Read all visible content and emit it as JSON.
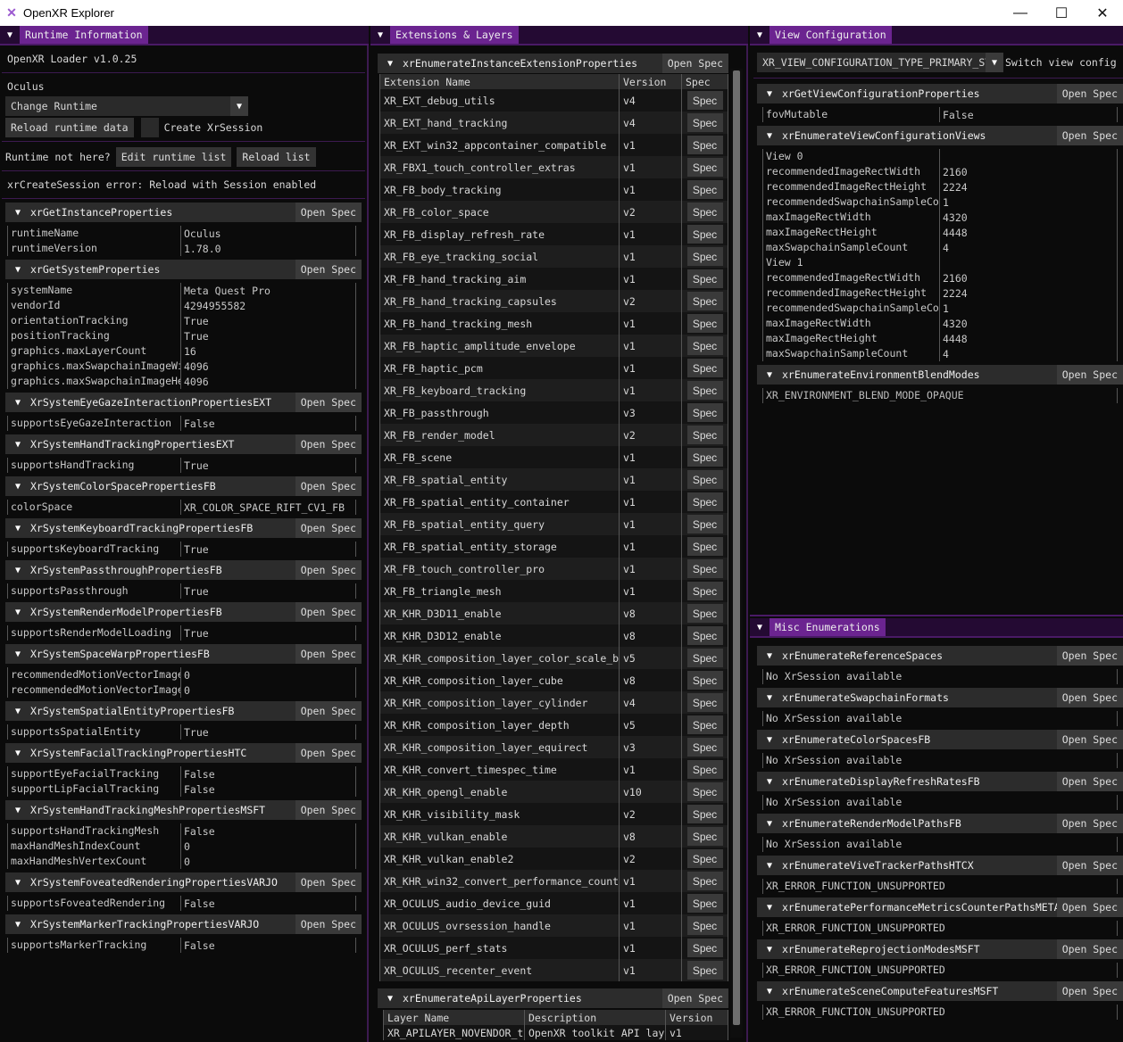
{
  "window": {
    "title": "OpenXR Explorer",
    "minimize": "—",
    "maximize": "☐",
    "close": "✕"
  },
  "runtime": {
    "tab": "Runtime Information",
    "loader": "OpenXR Loader v1.0.25",
    "runtime_name": "Oculus",
    "change_runtime": "Change Runtime",
    "reload_runtime": "Reload runtime data",
    "create_session": "Create XrSession",
    "create_session_checked": false,
    "not_here": "Runtime not here?",
    "edit_list": "Edit runtime list",
    "reload_list": "Reload list",
    "error": "xrCreateSession error: Reload with Session enabled",
    "open_spec": "Open Spec",
    "sections": [
      {
        "name": "xrGetInstanceProperties",
        "rows": [
          [
            "runtimeName",
            "Oculus"
          ],
          [
            "runtimeVersion",
            "1.78.0"
          ]
        ]
      },
      {
        "name": "xrGetSystemProperties",
        "rows": [
          [
            "systemName",
            "Meta Quest Pro"
          ],
          [
            "vendorId",
            "4294955582"
          ],
          [
            "orientationTracking",
            "True"
          ],
          [
            "positionTracking",
            "True"
          ],
          [
            "graphics.maxLayerCount",
            "16"
          ],
          [
            "graphics.maxSwapchainImageWi",
            "4096"
          ],
          [
            "graphics.maxSwapchainImageHe",
            "4096"
          ]
        ]
      },
      {
        "name": "XrSystemEyeGazeInteractionPropertiesEXT",
        "rows": [
          [
            "supportsEyeGazeInteraction",
            "False"
          ]
        ]
      },
      {
        "name": "XrSystemHandTrackingPropertiesEXT",
        "rows": [
          [
            "supportsHandTracking",
            "True"
          ]
        ]
      },
      {
        "name": "XrSystemColorSpacePropertiesFB",
        "rows": [
          [
            "colorSpace",
            "XR_COLOR_SPACE_RIFT_CV1_FB"
          ]
        ]
      },
      {
        "name": "XrSystemKeyboardTrackingPropertiesFB",
        "rows": [
          [
            "supportsKeyboardTracking",
            "True"
          ]
        ]
      },
      {
        "name": "XrSystemPassthroughPropertiesFB",
        "rows": [
          [
            "supportsPassthrough",
            "True"
          ]
        ]
      },
      {
        "name": "XrSystemRenderModelPropertiesFB",
        "rows": [
          [
            "supportsRenderModelLoading",
            "True"
          ]
        ]
      },
      {
        "name": "XrSystemSpaceWarpPropertiesFB",
        "rows": [
          [
            "recommendedMotionVectorImage",
            "0"
          ],
          [
            "recommendedMotionVectorImage",
            "0"
          ]
        ]
      },
      {
        "name": "XrSystemSpatialEntityPropertiesFB",
        "rows": [
          [
            "supportsSpatialEntity",
            "True"
          ]
        ]
      },
      {
        "name": "XrSystemFacialTrackingPropertiesHTC",
        "rows": [
          [
            "supportEyeFacialTracking",
            "False"
          ],
          [
            "supportLipFacialTracking",
            "False"
          ]
        ]
      },
      {
        "name": "XrSystemHandTrackingMeshPropertiesMSFT",
        "rows": [
          [
            "supportsHandTrackingMesh",
            "False"
          ],
          [
            "maxHandMeshIndexCount",
            "0"
          ],
          [
            "maxHandMeshVertexCount",
            "0"
          ]
        ]
      },
      {
        "name": "XrSystemFoveatedRenderingPropertiesVARJO",
        "rows": [
          [
            "supportsFoveatedRendering",
            "False"
          ]
        ]
      },
      {
        "name": "XrSystemMarkerTrackingPropertiesVARJO",
        "rows": [
          [
            "supportsMarkerTracking",
            "False"
          ]
        ]
      }
    ]
  },
  "extensions": {
    "tab": "Extensions & Layers",
    "instance_header": "xrEnumerateInstanceExtensionProperties",
    "open_spec": "Open Spec",
    "columns": [
      "Extension Name",
      "Version",
      "Spec"
    ],
    "spec_label": "Spec",
    "rows": [
      [
        "XR_EXT_debug_utils",
        "v4"
      ],
      [
        "XR_EXT_hand_tracking",
        "v4"
      ],
      [
        "XR_EXT_win32_appcontainer_compatible",
        "v1"
      ],
      [
        "XR_FBX1_touch_controller_extras",
        "v1"
      ],
      [
        "XR_FB_body_tracking",
        "v1"
      ],
      [
        "XR_FB_color_space",
        "v2"
      ],
      [
        "XR_FB_display_refresh_rate",
        "v1"
      ],
      [
        "XR_FB_eye_tracking_social",
        "v1"
      ],
      [
        "XR_FB_hand_tracking_aim",
        "v1"
      ],
      [
        "XR_FB_hand_tracking_capsules",
        "v2"
      ],
      [
        "XR_FB_hand_tracking_mesh",
        "v1"
      ],
      [
        "XR_FB_haptic_amplitude_envelope",
        "v1"
      ],
      [
        "XR_FB_haptic_pcm",
        "v1"
      ],
      [
        "XR_FB_keyboard_tracking",
        "v1"
      ],
      [
        "XR_FB_passthrough",
        "v3"
      ],
      [
        "XR_FB_render_model",
        "v2"
      ],
      [
        "XR_FB_scene",
        "v1"
      ],
      [
        "XR_FB_spatial_entity",
        "v1"
      ],
      [
        "XR_FB_spatial_entity_container",
        "v1"
      ],
      [
        "XR_FB_spatial_entity_query",
        "v1"
      ],
      [
        "XR_FB_spatial_entity_storage",
        "v1"
      ],
      [
        "XR_FB_touch_controller_pro",
        "v1"
      ],
      [
        "XR_FB_triangle_mesh",
        "v1"
      ],
      [
        "XR_KHR_D3D11_enable",
        "v8"
      ],
      [
        "XR_KHR_D3D12_enable",
        "v8"
      ],
      [
        "XR_KHR_composition_layer_color_scale_b",
        "v5"
      ],
      [
        "XR_KHR_composition_layer_cube",
        "v8"
      ],
      [
        "XR_KHR_composition_layer_cylinder",
        "v4"
      ],
      [
        "XR_KHR_composition_layer_depth",
        "v5"
      ],
      [
        "XR_KHR_composition_layer_equirect",
        "v3"
      ],
      [
        "XR_KHR_convert_timespec_time",
        "v1"
      ],
      [
        "XR_KHR_opengl_enable",
        "v10"
      ],
      [
        "XR_KHR_visibility_mask",
        "v2"
      ],
      [
        "XR_KHR_vulkan_enable",
        "v8"
      ],
      [
        "XR_KHR_vulkan_enable2",
        "v2"
      ],
      [
        "XR_KHR_win32_convert_performance_count",
        "v1"
      ],
      [
        "XR_OCULUS_audio_device_guid",
        "v1"
      ],
      [
        "XR_OCULUS_ovrsession_handle",
        "v1"
      ],
      [
        "XR_OCULUS_perf_stats",
        "v1"
      ],
      [
        "XR_OCULUS_recenter_event",
        "v1"
      ]
    ],
    "layer_header": "xrEnumerateApiLayerProperties",
    "layer_columns": [
      "Layer Name",
      "Description",
      "Version"
    ],
    "layer_rows": [
      [
        "XR_APILAYER_NOVENDOR_t",
        "OpenXR toolkit API lay",
        "v1"
      ]
    ]
  },
  "view_config": {
    "tab": "View Configuration",
    "selected": "XR_VIEW_CONFIGURATION_TYPE_PRIMARY_STEREO",
    "switch_label": "Switch view config",
    "open_spec": "Open Spec",
    "props_header": "xrGetViewConfigurationProperties",
    "props_rows": [
      [
        "fovMutable",
        "False"
      ]
    ],
    "views_header": "xrEnumerateViewConfigurationViews",
    "views_rows": [
      [
        "View 0",
        ""
      ],
      [
        "recommendedImageRectWidth",
        "2160"
      ],
      [
        "recommendedImageRectHeight",
        "2224"
      ],
      [
        "recommendedSwapchainSampleCo",
        "1"
      ],
      [
        "maxImageRectWidth",
        "4320"
      ],
      [
        "maxImageRectHeight",
        "4448"
      ],
      [
        "maxSwapchainSampleCount",
        "4"
      ],
      [
        "View 1",
        ""
      ],
      [
        "recommendedImageRectWidth",
        "2160"
      ],
      [
        "recommendedImageRectHeight",
        "2224"
      ],
      [
        "recommendedSwapchainSampleCo",
        "1"
      ],
      [
        "maxImageRectWidth",
        "4320"
      ],
      [
        "maxImageRectHeight",
        "4448"
      ],
      [
        "maxSwapchainSampleCount",
        "4"
      ]
    ],
    "blend_header": "xrEnumerateEnvironmentBlendModes",
    "blend_rows": [
      "XR_ENVIRONMENT_BLEND_MODE_OPAQUE"
    ]
  },
  "misc": {
    "tab": "Misc Enumerations",
    "open_spec": "Open Spec",
    "sections": [
      {
        "name": "xrEnumerateReferenceSpaces",
        "value": "No XrSession available"
      },
      {
        "name": "xrEnumerateSwapchainFormats",
        "value": "No XrSession available"
      },
      {
        "name": "xrEnumerateColorSpacesFB",
        "value": "No XrSession available"
      },
      {
        "name": "xrEnumerateDisplayRefreshRatesFB",
        "value": "No XrSession available"
      },
      {
        "name": "xrEnumerateRenderModelPathsFB",
        "value": "No XrSession available"
      },
      {
        "name": "xrEnumerateViveTrackerPathsHTCX",
        "value": "XR_ERROR_FUNCTION_UNSUPPORTED"
      },
      {
        "name": "xrEnumeratePerformanceMetricsCounterPathsMETA",
        "value": "XR_ERROR_FUNCTION_UNSUPPORTED"
      },
      {
        "name": "xrEnumerateReprojectionModesMSFT",
        "value": "XR_ERROR_FUNCTION_UNSUPPORTED"
      },
      {
        "name": "xrEnumerateSceneComputeFeaturesMSFT",
        "value": "XR_ERROR_FUNCTION_UNSUPPORTED"
      }
    ]
  }
}
